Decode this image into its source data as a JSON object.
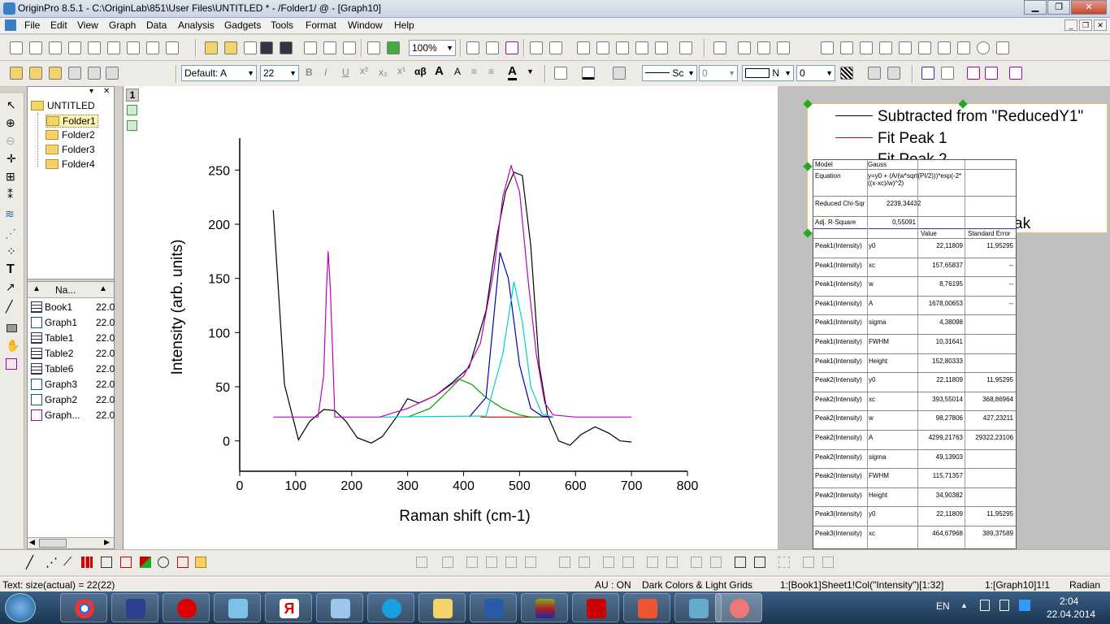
{
  "window": {
    "title": "OriginPro 8.5.1 - C:\\OriginLab\\851\\User Files\\UNTITLED * - /Folder1/ @ - [Graph10]"
  },
  "menu": [
    "File",
    "Edit",
    "View",
    "Graph",
    "Data",
    "Analysis",
    "Gadgets",
    "Tools",
    "Format",
    "Window",
    "Help"
  ],
  "toolbar": {
    "zoom": "100%",
    "font": "Default: A",
    "fontsize": "22",
    "greek": "αβ",
    "linestyle": "Sc",
    "linewidth": "0",
    "fill": "N",
    "pattern": "0"
  },
  "project": {
    "root": "UNTITLED",
    "folders": [
      "Folder1",
      "Folder2",
      "Folder3",
      "Folder4"
    ],
    "list_header": "Na...",
    "items": [
      {
        "name": "Book1",
        "val": "22.0"
      },
      {
        "name": "Graph1",
        "val": "22.0"
      },
      {
        "name": "Table1",
        "val": "22.0"
      },
      {
        "name": "Table2",
        "val": "22.0"
      },
      {
        "name": "Table6",
        "val": "22.0"
      },
      {
        "name": "Graph3",
        "val": "22.0"
      },
      {
        "name": "Graph2",
        "val": "22.0"
      },
      {
        "name": "Graph...",
        "val": "22.0"
      }
    ]
  },
  "layer_number": "1",
  "chart_data": {
    "type": "line",
    "xlabel": "Raman shift (cm-1)",
    "ylabel": "Intensity (arb. units)",
    "xlim": [
      0,
      800
    ],
    "ylim": [
      -28,
      275
    ],
    "xticks": [
      0,
      100,
      200,
      300,
      400,
      500,
      600,
      700,
      800
    ],
    "yticks": [
      0,
      50,
      100,
      150,
      200,
      250
    ],
    "series": [
      {
        "name": "Subtracted from \"ReducedY1\"",
        "color": "#000000",
        "x": [
          60,
          80,
          105,
          125,
          150,
          170,
          190,
          210,
          235,
          255,
          280,
          300,
          320,
          350,
          380,
          410,
          440,
          460,
          475,
          490,
          505,
          520,
          535,
          550,
          570,
          590,
          610,
          635,
          660,
          680,
          700
        ],
        "y": [
          213,
          52,
          1,
          18,
          29,
          28,
          18,
          3,
          -2,
          4,
          22,
          39,
          35,
          42,
          54,
          68,
          120,
          190,
          230,
          248,
          245,
          180,
          70,
          24,
          0,
          -4,
          6,
          13,
          7,
          0,
          -1
        ]
      },
      {
        "name": "Fit Peak 1",
        "color": "#d00000",
        "x": [
          430,
          460,
          480,
          500,
          520,
          540,
          560
        ],
        "y": [
          22,
          22,
          22,
          22,
          22,
          22,
          22
        ]
      },
      {
        "name": "Fit Peak 2",
        "color": "#00a000",
        "x": [
          300,
          340,
          370,
          393,
          415,
          440,
          470,
          500,
          520,
          540
        ],
        "y": [
          22,
          30,
          45,
          57,
          52,
          40,
          30,
          24,
          22,
          22
        ]
      },
      {
        "name": "Fit Peak 3",
        "color": "#0000b0",
        "x": [
          410,
          440,
          455,
          465,
          480,
          500,
          520,
          540,
          560
        ],
        "y": [
          22,
          40,
          120,
          174,
          150,
          70,
          30,
          23,
          22
        ]
      },
      {
        "name": "Fit Peak 4",
        "color": "#00d0d0",
        "x": [
          250,
          440,
          470,
          490,
          505,
          520,
          540,
          560
        ],
        "y": [
          22,
          23,
          80,
          147,
          110,
          50,
          25,
          22
        ]
      },
      {
        "name": "Cumulative Fit Peak",
        "color": "#c000c0",
        "x": [
          60,
          140,
          150,
          155,
          158,
          162,
          170,
          250,
          300,
          350,
          400,
          430,
          455,
          470,
          485,
          500,
          515,
          530,
          545,
          560,
          600,
          700
        ],
        "y": [
          22,
          22,
          60,
          140,
          175,
          140,
          22,
          22,
          30,
          42,
          60,
          90,
          160,
          225,
          254,
          230,
          150,
          80,
          35,
          24,
          22,
          22
        ]
      }
    ]
  },
  "legend": {
    "entries": [
      "Subtracted from \"ReducedY1\"",
      "Fit Peak 1",
      "Fit Peak 2",
      "ak"
    ]
  },
  "fit": {
    "model_label": "Model",
    "model": "Gauss",
    "equation_label": "Equation",
    "equation": "y=y0 + (A/(w*sqrt(PI/2)))*exp(-2*((x-xc)/w)^2)",
    "chisq_label": "Reduced Chi-Sqr",
    "chisq": "2239,34432",
    "r2_label": "Adj. R-Square",
    "r2": "0,55091",
    "col_value": "Value",
    "col_err": "Standard Error",
    "rows": [
      [
        "Peak1(Intensity)",
        "y0",
        "22,11809",
        "11,95295"
      ],
      [
        "Peak1(Intensity)",
        "xc",
        "157,65837",
        "--"
      ],
      [
        "Peak1(Intensity)",
        "w",
        "8,76195",
        "--"
      ],
      [
        "Peak1(Intensity)",
        "A",
        "1678,00653",
        "--"
      ],
      [
        "Peak1(Intensity)",
        "sigma",
        "4,38098",
        ""
      ],
      [
        "Peak1(Intensity)",
        "FWHM",
        "10,31641",
        ""
      ],
      [
        "Peak1(Intensity)",
        "Height",
        "152,80333",
        ""
      ],
      [
        "Peak2(Intensity)",
        "y0",
        "22,11809",
        "11,95295"
      ],
      [
        "Peak2(Intensity)",
        "xc",
        "393,55014",
        "368,86964"
      ],
      [
        "Peak2(Intensity)",
        "w",
        "98,27806",
        "427,23211"
      ],
      [
        "Peak2(Intensity)",
        "A",
        "4299,21763",
        "29322,23106"
      ],
      [
        "Peak2(Intensity)",
        "sigma",
        "49,13903",
        ""
      ],
      [
        "Peak2(Intensity)",
        "FWHM",
        "115,71357",
        ""
      ],
      [
        "Peak2(Intensity)",
        "Height",
        "34,90382",
        ""
      ],
      [
        "Peak3(Intensity)",
        "y0",
        "22,11809",
        "11,95295"
      ],
      [
        "Peak3(Intensity)",
        "xc",
        "464,67968",
        "389,37589"
      ]
    ]
  },
  "status": {
    "left": "Text: size(actual) = 22(22)",
    "au": "AU : ON",
    "theme": "Dark Colors & Light Grids",
    "cell": "1:[Book1]Sheet1!Col(\"Intensity\")[1:32]",
    "graph": "1:[Graph10]1!1",
    "unit": "Radian"
  },
  "tray": {
    "lang": "EN",
    "time": "2:04",
    "date": "22.04.2014"
  }
}
